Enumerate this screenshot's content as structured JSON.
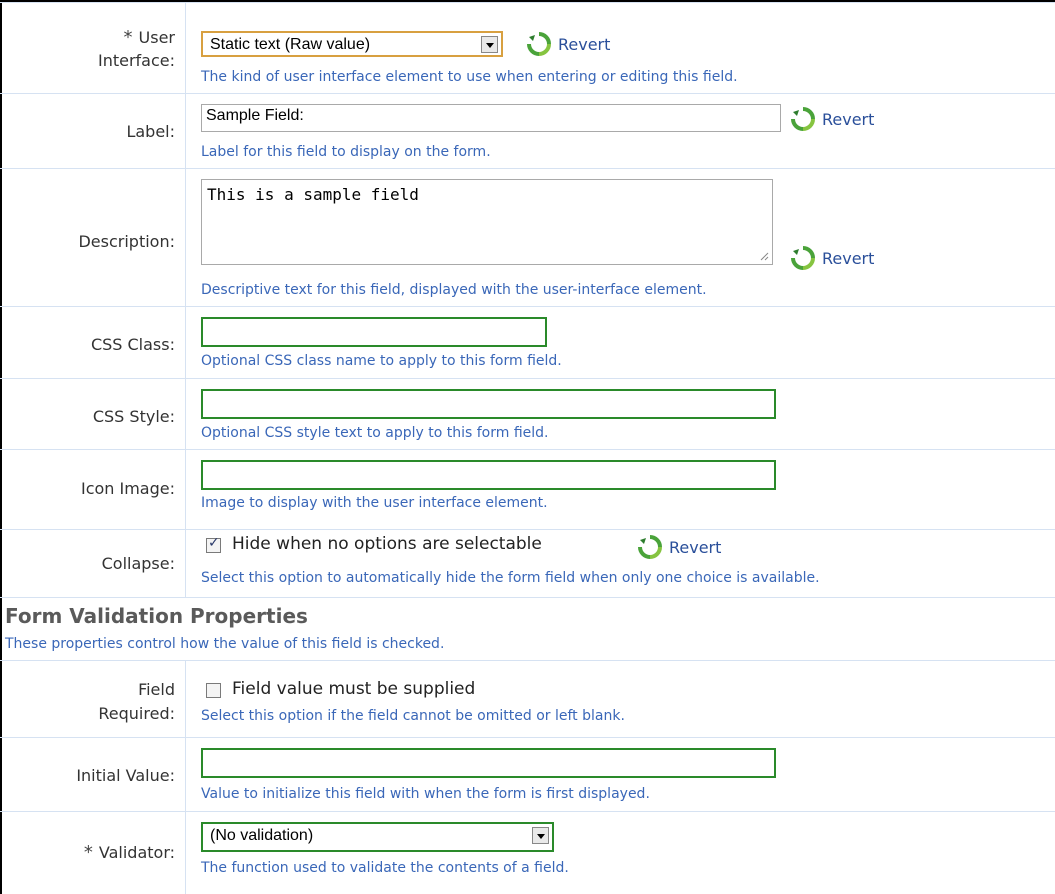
{
  "fields": {
    "user_interface": {
      "required_mark": "*",
      "label_line1": "User",
      "label_line2": "Interface:",
      "value": "Static text (Raw value)",
      "revert": "Revert",
      "help": "The kind of user interface element to use when entering or editing this field."
    },
    "label": {
      "label": "Label:",
      "value": "Sample Field:",
      "revert": "Revert",
      "help": "Label for this field to display on the form."
    },
    "description": {
      "label": "Description:",
      "value": "This is a sample field",
      "revert": "Revert",
      "help": "Descriptive text for this field, displayed with the user-interface element."
    },
    "css_class": {
      "label": "CSS Class:",
      "value": "",
      "help": "Optional CSS class name to apply to this form field."
    },
    "css_style": {
      "label": "CSS Style:",
      "value": "",
      "help": "Optional CSS style text to apply to this form field."
    },
    "icon_image": {
      "label": "Icon Image:",
      "value": "",
      "help": "Image to display with the user interface element."
    },
    "collapse": {
      "label": "Collapse:",
      "checkbox_label": "Hide when no options are selectable",
      "checked": true,
      "revert": "Revert",
      "help": "Select this option to automatically hide the form field when only one choice is available."
    }
  },
  "validation_section": {
    "title": "Form Validation Properties",
    "help": "These properties control how the value of this field is checked."
  },
  "validation_fields": {
    "field_required": {
      "label_line1": "Field",
      "label_line2": "Required:",
      "checkbox_label": "Field value must be supplied",
      "checked": false,
      "help": "Select this option if the field cannot be omitted or left blank."
    },
    "initial_value": {
      "label": "Initial Value:",
      "value": "",
      "help": "Value to initialize this field with when the form is first displayed."
    },
    "validator": {
      "required_mark": "*",
      "label": "Validator:",
      "value": "(No validation)",
      "help": "The function used to validate the contents of a field."
    }
  },
  "colors": {
    "help_text": "#3a67b8",
    "revert_link": "#2a4f9a",
    "field_border_active": "#2a8a2a",
    "select_border_highlight": "#d8a040",
    "row_divider": "#d6e2f2"
  },
  "icons": {
    "revert": "revert-icon"
  }
}
